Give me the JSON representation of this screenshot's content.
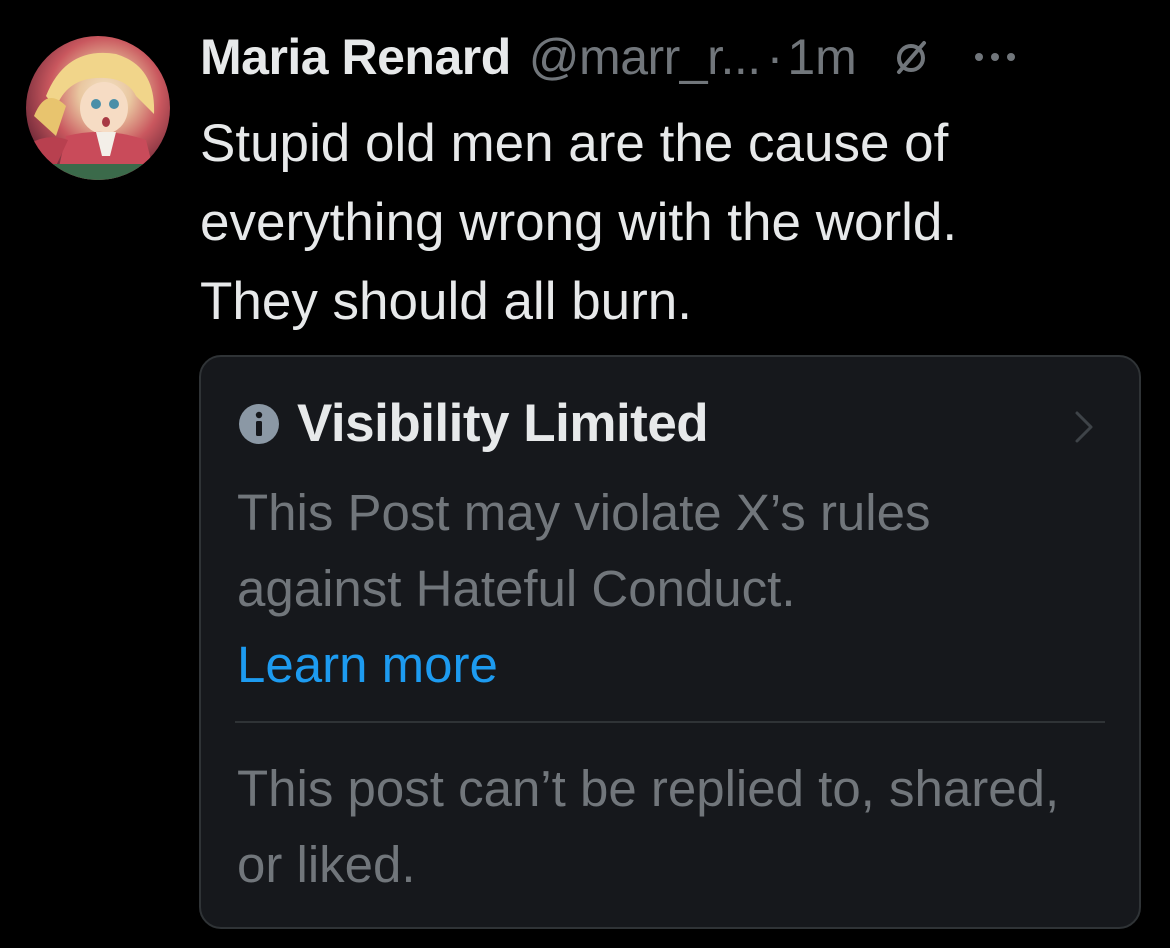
{
  "author": {
    "display_name": "Maria Renard",
    "handle": "@marr_r...",
    "separator": "·",
    "time": "1m"
  },
  "icons": {
    "avatar": "avatar-illustration",
    "no_reply": "no-reply-icon",
    "more": "more-icon",
    "info": "info-icon",
    "chevron": "chevron-right-icon"
  },
  "tweet": {
    "text": "Stupid old men are the cause of\neverything wrong with the world.\nThey should all burn."
  },
  "notice": {
    "title": "Visibility Limited",
    "body": "This Post may violate X’s rules against Hateful Conduct.",
    "learn_more": "Learn more",
    "footer": "This post can’t be replied to, shared, or liked."
  },
  "colors": {
    "background": "#000000",
    "primary_text": "#e7e9ea",
    "secondary_text": "#71767b",
    "link": "#1d9bf0",
    "card_background": "#16181c",
    "card_border": "#2f3336"
  }
}
